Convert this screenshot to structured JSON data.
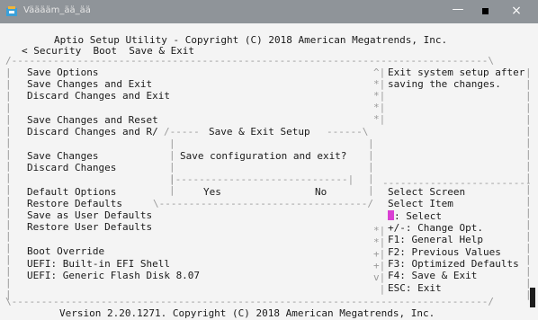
{
  "window": {
    "title": "Vääääm_ää_ää",
    "minimize_glyph": "—",
    "close_glyph": "×"
  },
  "header": {
    "title": "Aptio Setup Utility - Copyright (C) 2018 American Megatrends, Inc.",
    "tabs_line": "< Security  Boot  Save & Exit"
  },
  "menu": {
    "save_options_heading": "Save Options",
    "save_changes_and_exit": "Save Changes and Exit",
    "discard_changes_and_exit": "Discard Changes and Exit",
    "save_changes_and_reset": "Save Changes and Reset",
    "discard_changes_and_reset": "Discard Changes and R/",
    "save_changes": "Save Changes",
    "discard_changes": "Discard Changes",
    "default_options_heading": "Default Options",
    "restore_defaults": "Restore Defaults",
    "save_as_user_defaults": "Save as User Defaults",
    "restore_user_defaults": "Restore User Defaults",
    "boot_override_heading": "Boot Override",
    "uefi_builtin_shell": "UEFI: Built-in EFI Shell",
    "uefi_flash_disk": "UEFI: Generic Flash Disk 8.07"
  },
  "help": {
    "line1": "Exit system setup after",
    "line2": "saving the changes."
  },
  "dialog": {
    "title": "Save & Exit Setup",
    "message": "Save configuration and exit?",
    "yes_label": "Yes",
    "no_label": "No"
  },
  "keys": {
    "select_screen": "Select Screen",
    "select_item": "Select Item",
    "enter_select": ": Select",
    "change_opt": "+/-: Change Opt.",
    "general_help": "F1: General Help",
    "previous_values": "F2: Previous Values",
    "optimized_defaults": "F3: Optimized Defaults",
    "save_exit": "F4: Save & Exit",
    "esc_exit": "ESC: Exit"
  },
  "footer": {
    "version": "Version 2.20.1271. Copyright (C) 2018 American Megatrends, Inc."
  },
  "colors": {
    "titlebar": "#8f9499",
    "background": "#f4f4f4",
    "text": "#1a1a1a",
    "highlight": "#d93fd3"
  }
}
